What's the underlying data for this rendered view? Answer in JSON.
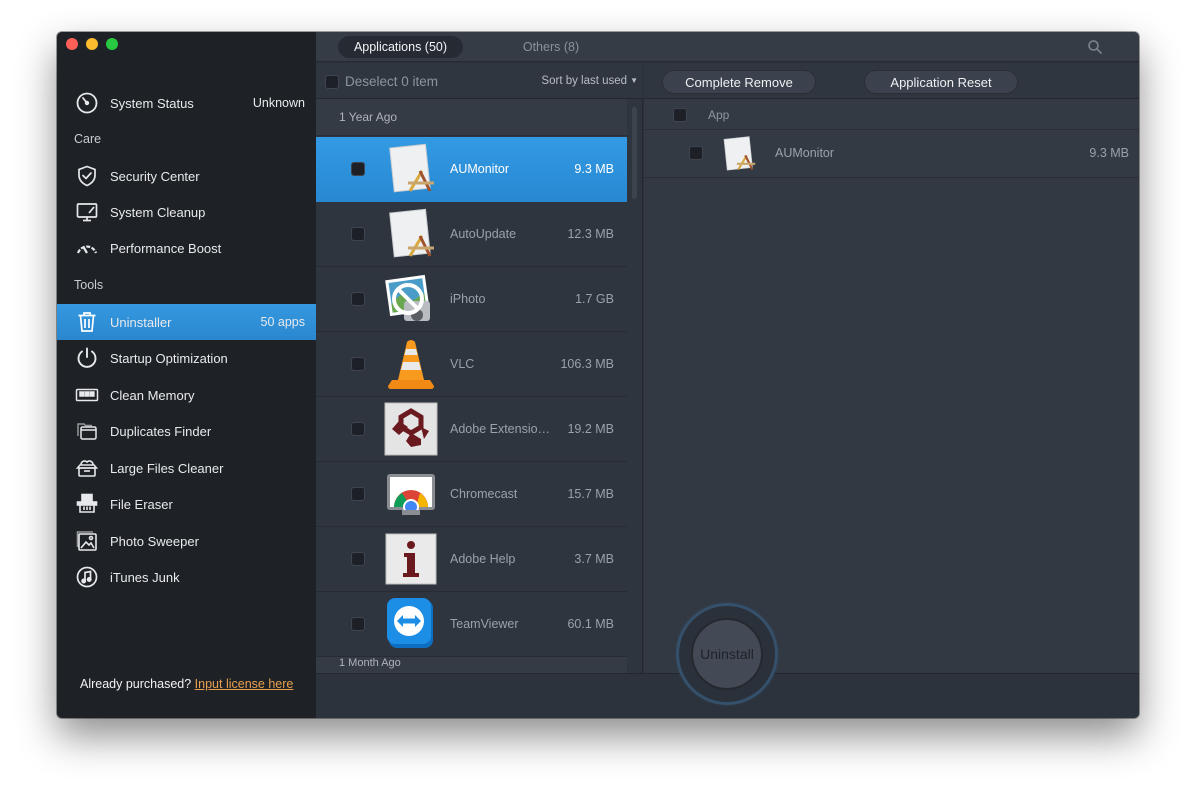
{
  "window": {
    "traffic_lights": [
      "close",
      "minimize",
      "maximize"
    ]
  },
  "sidebar": {
    "status": {
      "label": "System Status",
      "value": "Unknown",
      "icon": "gauge-icon"
    },
    "sections": {
      "care": "Care",
      "tools": "Tools"
    },
    "care_items": [
      {
        "label": "Security Center",
        "icon": "shield-check-icon"
      },
      {
        "label": "System Cleanup",
        "icon": "monitor-broom-icon"
      },
      {
        "label": "Performance Boost",
        "icon": "speedometer-icon"
      }
    ],
    "tool_items": [
      {
        "label": "Uninstaller",
        "badge": "50 apps",
        "icon": "trash-icon",
        "active": true
      },
      {
        "label": "Startup Optimization",
        "icon": "power-icon"
      },
      {
        "label": "Clean Memory",
        "icon": "memory-chip-icon"
      },
      {
        "label": "Duplicates Finder",
        "icon": "folders-icon"
      },
      {
        "label": "Large Files Cleaner",
        "icon": "basket-icon"
      },
      {
        "label": "File Eraser",
        "icon": "shredder-icon"
      },
      {
        "label": "Photo Sweeper",
        "icon": "photo-icon"
      },
      {
        "label": "iTunes Junk",
        "icon": "music-note-icon"
      }
    ],
    "license": {
      "prompt": "Already purchased?",
      "link": "Input license here"
    }
  },
  "topbar": {
    "tabs": [
      {
        "label": "Applications (50)",
        "active": true
      },
      {
        "label": "Others (8)",
        "active": false
      }
    ],
    "search_icon": "search-icon"
  },
  "list": {
    "deselect_label": "Deselect 0 item",
    "sort_label": "Sort by last used",
    "groups": [
      {
        "title": "1 Year Ago",
        "apps": [
          {
            "name": "AUMonitor",
            "size": "9.3 MB",
            "icon": "xcode-doc-icon",
            "selected": true
          },
          {
            "name": "AutoUpdate",
            "size": "12.3 MB",
            "icon": "xcode-doc-icon"
          },
          {
            "name": "iPhoto",
            "size": "1.7 GB",
            "icon": "iphoto-icon"
          },
          {
            "name": "VLC",
            "size": "106.3 MB",
            "icon": "vlc-cone-icon"
          },
          {
            "name": "Adobe Extensio…",
            "size": "19.2 MB",
            "icon": "adobe-extension-icon"
          },
          {
            "name": "Chromecast",
            "size": "15.7 MB",
            "icon": "chromecast-icon"
          },
          {
            "name": "Adobe Help",
            "size": "3.7 MB",
            "icon": "adobe-help-icon"
          },
          {
            "name": "TeamViewer",
            "size": "60.1 MB",
            "icon": "teamviewer-icon"
          }
        ]
      },
      {
        "title": "1 Month Ago"
      }
    ]
  },
  "detail": {
    "actions": {
      "complete_remove": "Complete Remove",
      "application_reset": "Application Reset"
    },
    "column_header": "App",
    "items": [
      {
        "name": "AUMonitor",
        "size": "9.3 MB",
        "icon": "xcode-doc-icon"
      }
    ]
  },
  "bottom": {
    "uninstall_label": "Uninstall"
  },
  "colors": {
    "accent": "#2f8fd9",
    "link": "#e8a04e",
    "sidebar_bg": "#1e2126",
    "panel_bg": "#2f353e"
  }
}
